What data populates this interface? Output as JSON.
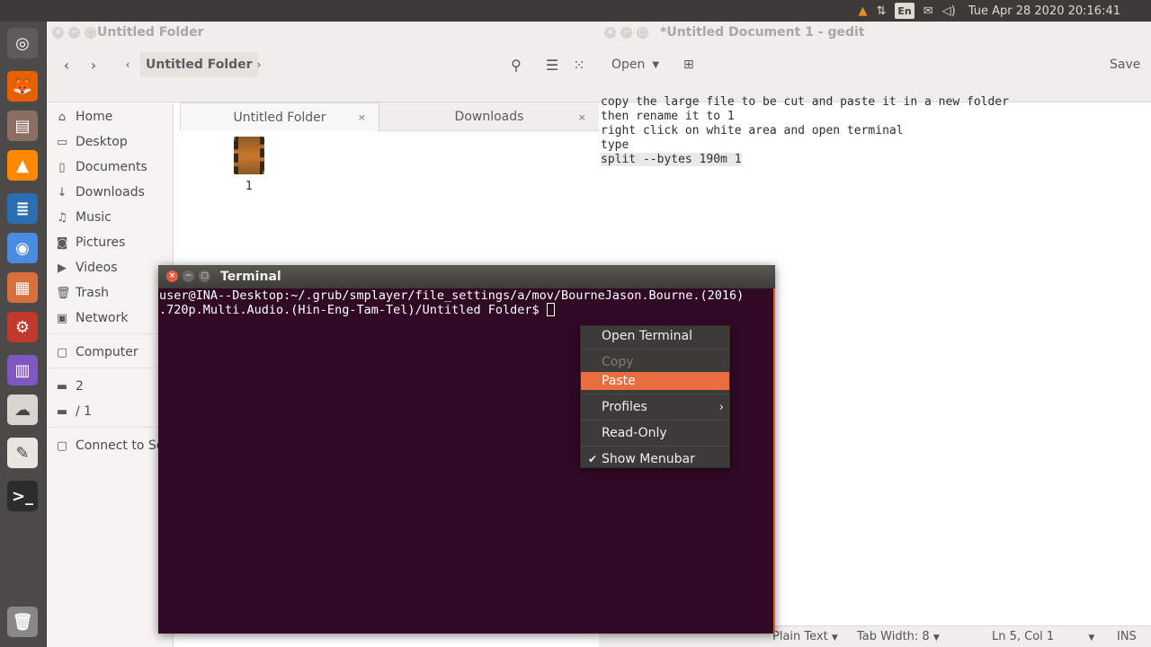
{
  "topbar": {
    "keyboard_layout": "En",
    "clock": "Tue Apr 28 2020 20:16:41",
    "icons": [
      "vlc-tray-icon",
      "network-icon",
      "keyboard-icon",
      "mail-icon",
      "volume-icon"
    ]
  },
  "launcher": {
    "items": [
      {
        "name": "ubuntu-dash-icon",
        "color": "#5e5c5a",
        "glyph": "◎"
      },
      {
        "name": "firefox-icon",
        "color": "#e66000",
        "glyph": "🦊"
      },
      {
        "name": "files-icon",
        "color": "#8d6e63",
        "glyph": "▤"
      },
      {
        "name": "vlc-icon",
        "color": "#ff8800",
        "glyph": "▲"
      },
      {
        "name": "writer-icon",
        "color": "#2a6fb1",
        "glyph": "≣"
      },
      {
        "name": "chromium-icon",
        "color": "#4a8de0",
        "glyph": "◉"
      },
      {
        "name": "impress-icon",
        "color": "#d9703c",
        "glyph": "▦"
      },
      {
        "name": "settings-icon",
        "color": "#c0392b",
        "glyph": "⚙"
      },
      {
        "name": "software-icon",
        "color": "#7e57c2",
        "glyph": "▥"
      },
      {
        "name": "ubuntu-one-icon",
        "color": "#d8d4d0",
        "glyph": "☁"
      },
      {
        "name": "text-editor-icon",
        "color": "#e8e6e1",
        "glyph": "✎"
      },
      {
        "name": "terminal-icon",
        "color": "#2c2c2c",
        "glyph": ">_"
      }
    ],
    "trash_icon": "trash-icon"
  },
  "files": {
    "title": "Untitled Folder",
    "path_current": "Untitled Folder",
    "sidebar": [
      {
        "icon": "home-icon",
        "glyph": "⌂",
        "label": "Home"
      },
      {
        "icon": "desktop-icon",
        "glyph": "▭",
        "label": "Desktop"
      },
      {
        "icon": "documents-icon",
        "glyph": "▯",
        "label": "Documents"
      },
      {
        "icon": "downloads-icon",
        "glyph": "↓",
        "label": "Downloads"
      },
      {
        "icon": "music-icon",
        "glyph": "♫",
        "label": "Music"
      },
      {
        "icon": "pictures-icon",
        "glyph": "◙",
        "label": "Pictures"
      },
      {
        "icon": "videos-icon",
        "glyph": "▶",
        "label": "Videos"
      },
      {
        "icon": "trash-icon",
        "glyph": "🗑",
        "label": "Trash"
      },
      {
        "icon": "network-icon",
        "glyph": "▣",
        "label": "Network"
      },
      {
        "icon": "computer-icon",
        "glyph": "▢",
        "label": "Computer"
      },
      {
        "icon": "folder-icon",
        "glyph": "▬",
        "label": "2"
      },
      {
        "icon": "folder-icon",
        "glyph": "▬",
        "label": "/ 1"
      },
      {
        "icon": "server-icon",
        "glyph": "▢",
        "label": "Connect to Se"
      }
    ],
    "tabs": [
      {
        "label": "Untitled Folder",
        "close": "×"
      },
      {
        "label": "Downloads",
        "close": "×"
      }
    ],
    "file": {
      "name": "1",
      "icon": "video-file-icon"
    }
  },
  "gedit": {
    "title": "*Untitled Document 1 - gedit",
    "open_label": "Open",
    "save_label": "Save",
    "lines": [
      "copy the large file to be cut and paste it in a new folder",
      "then rename it to 1",
      "right click on white area and open terminal",
      "type",
      "split --bytes 190m 1"
    ],
    "status": {
      "language": "Plain Text",
      "tab_width": "Tab Width: 8",
      "position": "Ln 5, Col 1",
      "mode": "INS"
    }
  },
  "terminal": {
    "title": "Terminal",
    "line1": "user@INA--Desktop:~/.grub/smplayer/file_settings/a/mov/BourneJason.Bourne.(2016)",
    "line2": ".720p.Multi.Audio.(Hin-Eng-Tam-Tel)/Untitled Folder$ "
  },
  "context_menu": {
    "items": [
      {
        "label": "Open Terminal",
        "state": "normal"
      },
      {
        "label": "Copy",
        "state": "disabled"
      },
      {
        "label": "Paste",
        "state": "hover"
      },
      {
        "label": "Profiles",
        "state": "submenu"
      },
      {
        "label": "Read-Only",
        "state": "normal"
      },
      {
        "label": "Show Menubar",
        "state": "checked"
      }
    ],
    "accent": "#e96d3f"
  }
}
